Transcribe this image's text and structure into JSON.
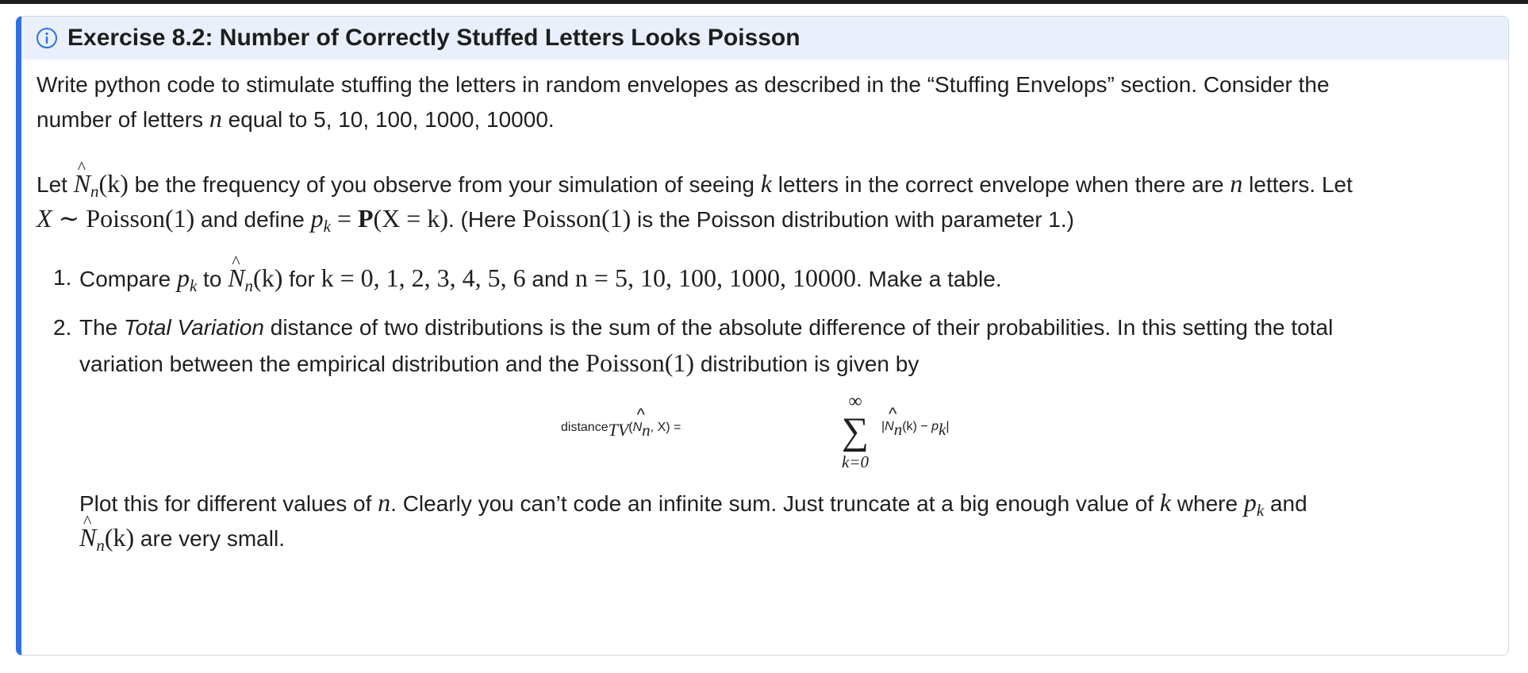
{
  "callout": {
    "title": "Exercise 8.2: Number of Correctly Stuffed Letters Looks Poisson",
    "icon": "info-circle-icon",
    "accent_color": "#2f6fe4",
    "header_bg": "#eaf0fb"
  },
  "para1": {
    "line1": "Write python code to stimulate stuffing the letters in random envelopes as described in the “Stuffing Envelops” section. Consider the",
    "line2_a": "number of letters ",
    "line2_n": "n",
    "line2_b": " equal to 5, 10, 100, 1000, 10000."
  },
  "para2": {
    "let": "Let ",
    "N": "N",
    "sub_n": "n",
    "k_paren": "(k)",
    "a": " be the frequency of you observe from your simulation of seeing ",
    "k": "k",
    "b": " letters in the correct envelope when there are ",
    "n": "n",
    "c": " letters. Let",
    "X": "X",
    "sim": " ∼ Poisson(1)",
    "d": " and define ",
    "p": "p",
    "sub_k": "k",
    "eq": " = ",
    "P": "P",
    "Xk": "(X = k)",
    "e": ". (Here ",
    "poisson1": "Poisson(1)",
    "f": " is the Poisson distribution with parameter 1.)"
  },
  "item1": {
    "num": "1.",
    "compare": "Compare ",
    "p": "p",
    "sub_k": "k",
    "to": " to ",
    "N": "N",
    "sub_n": "n",
    "k_paren": "(k)",
    "for": " for ",
    "kvals": "k = 0, 1, 2, 3, 4, 5, 6",
    "and": " and ",
    "nvals": "n = 5, 10, 100, 1000, 10000",
    "end": ". Make a table."
  },
  "item2": {
    "num": "2.",
    "a": "The ",
    "term": "Total Variation",
    "b": " distance of two distributions is the sum of the absolute difference of their probabilities. In this setting the total",
    "c": "variation between the empirical distribution and the ",
    "poisson1": "Poisson(1)",
    "d": " distribution is given by",
    "formula_lhs": "distance",
    "formula_sub": "TV",
    "formula_args_open": "(",
    "formula_N": "N",
    "formula_sub_n": "n",
    "formula_args_close": ", X) = ",
    "sum_top": "∞",
    "sum_sym": "∑",
    "sum_bottom": "k=0",
    "abs_open": "|",
    "abs_N": "N",
    "abs_sub_n": "n",
    "abs_k": "(k) − ",
    "abs_p": "p",
    "abs_sub_k": "k",
    "abs_close": "|",
    "plot_a": "Plot this for different values of ",
    "plot_n": "n",
    "plot_b": ". Clearly you can’t code an infinite sum. Just truncate at a big enough value of ",
    "plot_k": "k",
    "plot_c": " where ",
    "plot_p": "p",
    "plot_sub_k": "k",
    "plot_d": " and",
    "last_N": "N",
    "last_sub_n": "n",
    "last_k": "(k)",
    "last_text": " are very small."
  }
}
